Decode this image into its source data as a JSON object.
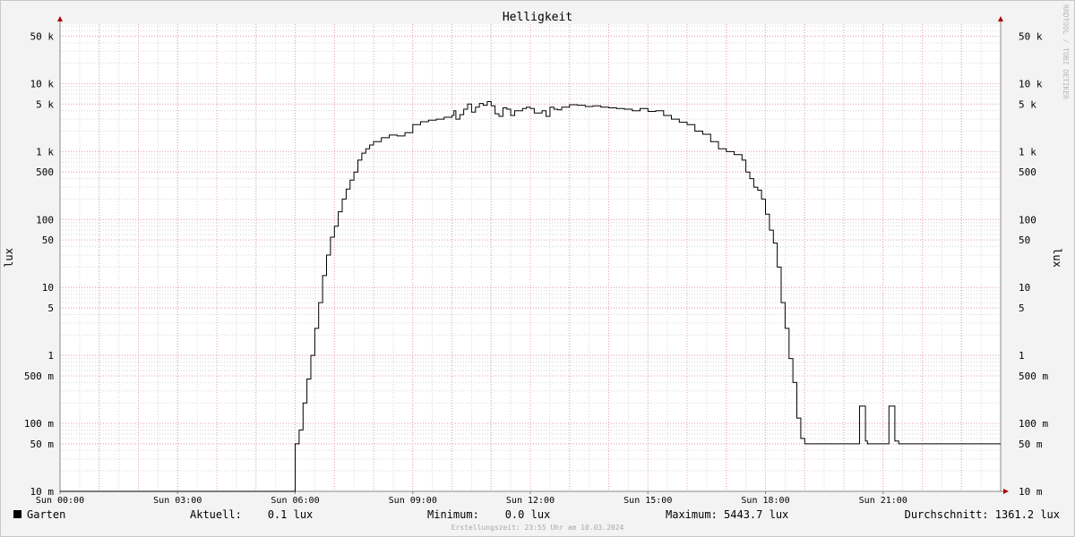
{
  "chart_data": {
    "type": "line",
    "title": "Helligkeit",
    "ylabel": "lux",
    "scale": "log",
    "ylim": [
      0.01,
      75000
    ],
    "xlim_hours": [
      0,
      24
    ],
    "grid": true,
    "x_ticks": [
      {
        "h": 0,
        "label": "Sun 00:00"
      },
      {
        "h": 3,
        "label": "Sun 03:00"
      },
      {
        "h": 6,
        "label": "Sun 06:00"
      },
      {
        "h": 9,
        "label": "Sun 09:00"
      },
      {
        "h": 12,
        "label": "Sun 12:00"
      },
      {
        "h": 15,
        "label": "Sun 15:00"
      },
      {
        "h": 18,
        "label": "Sun 18:00"
      },
      {
        "h": 21,
        "label": "Sun 21:00"
      }
    ],
    "y_ticks": [
      {
        "v": 50000,
        "label": "50 k"
      },
      {
        "v": 10000,
        "label": "10 k"
      },
      {
        "v": 5000,
        "label": "5 k"
      },
      {
        "v": 1000,
        "label": "1 k"
      },
      {
        "v": 500,
        "label": "500"
      },
      {
        "v": 100,
        "label": "100"
      },
      {
        "v": 50,
        "label": "50"
      },
      {
        "v": 10,
        "label": "10"
      },
      {
        "v": 5,
        "label": "5"
      },
      {
        "v": 1,
        "label": "1"
      },
      {
        "v": 0.5,
        "label": "500 m"
      },
      {
        "v": 0.1,
        "label": "100 m"
      },
      {
        "v": 0.05,
        "label": "50 m"
      },
      {
        "v": 0.01,
        "label": "10 m"
      }
    ],
    "series": [
      {
        "name": "Garten",
        "color": "#000000",
        "x": [
          0,
          6.0,
          6.0,
          6.1,
          6.2,
          6.3,
          6.4,
          6.5,
          6.6,
          6.7,
          6.8,
          6.9,
          7.0,
          7.1,
          7.2,
          7.3,
          7.4,
          7.5,
          7.6,
          7.7,
          7.8,
          7.9,
          8.0,
          8.2,
          8.4,
          8.6,
          8.8,
          9.0,
          9.2,
          9.4,
          9.6,
          9.8,
          10.0,
          10.05,
          10.1,
          10.2,
          10.3,
          10.4,
          10.5,
          10.6,
          10.7,
          10.8,
          10.9,
          11.0,
          11.1,
          11.2,
          11.3,
          11.4,
          11.5,
          11.6,
          11.8,
          11.9,
          12.0,
          12.1,
          12.3,
          12.4,
          12.5,
          12.6,
          12.7,
          12.8,
          13.0,
          13.2,
          13.4,
          13.6,
          13.8,
          14.0,
          14.2,
          14.4,
          14.6,
          14.8,
          15.0,
          15.2,
          15.4,
          15.6,
          15.8,
          16.0,
          16.2,
          16.4,
          16.6,
          16.8,
          17.0,
          17.2,
          17.4,
          17.5,
          17.6,
          17.7,
          17.8,
          17.9,
          18.0,
          18.1,
          18.2,
          18.3,
          18.4,
          18.5,
          18.6,
          18.7,
          18.8,
          18.9,
          19.0,
          19.1,
          19.15,
          19.2,
          20.35,
          20.4,
          20.5,
          20.55,
          20.6,
          21.1,
          21.15,
          21.25,
          21.3,
          21.4,
          24
        ],
        "values": [
          0.01,
          0.01,
          0.05,
          0.08,
          0.2,
          0.45,
          1.0,
          2.5,
          6.0,
          15,
          30,
          55,
          80,
          130,
          200,
          280,
          380,
          500,
          750,
          950,
          1100,
          1250,
          1400,
          1600,
          1750,
          1700,
          1900,
          2500,
          2750,
          2900,
          3000,
          3200,
          3400,
          4000,
          3000,
          3500,
          4200,
          5000,
          3800,
          4500,
          5100,
          4800,
          5443.7,
          4700,
          3600,
          3300,
          4400,
          4200,
          3400,
          4000,
          4300,
          4500,
          4300,
          3700,
          4000,
          3300,
          4500,
          4200,
          4100,
          4500,
          4900,
          4800,
          4600,
          4700,
          4500,
          4400,
          4300,
          4200,
          4000,
          4300,
          3900,
          4000,
          3400,
          3000,
          2700,
          2500,
          2000,
          1800,
          1400,
          1100,
          1000,
          900,
          750,
          500,
          400,
          300,
          270,
          200,
          120,
          70,
          45,
          20,
          6,
          2.5,
          0.9,
          0.4,
          0.12,
          0.06,
          0.05,
          0.05,
          0.05,
          0.05,
          0.05,
          0.18,
          0.18,
          0.055,
          0.05,
          0.05,
          0.18,
          0.18,
          0.055,
          0.05,
          0.05
        ]
      }
    ]
  },
  "side_text": "RRDTOOL / TOBI OETIKER",
  "legend": {
    "series_name": "Garten",
    "swatch_color": "#000000",
    "current": "Aktuell:    0.1 lux",
    "minimum": "Minimum:    0.0 lux",
    "maximum": "Maximum: 5443.7 lux",
    "average": "Durchschnitt: 1361.2 lux"
  },
  "footer": "Erstellungszeit: 23:55 Uhr am 10.03.2024",
  "colors": {
    "background": "#f3f3f3",
    "canvas": "#ffffff",
    "major_grid": "#e9a0a8",
    "minor_grid": "#d8d8d8",
    "axis": "#888888",
    "arrow": "#aa0000"
  }
}
